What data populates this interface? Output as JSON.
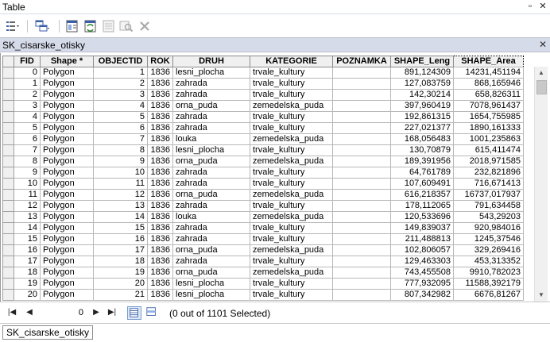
{
  "window": {
    "title": "Table",
    "pin_glyph": "▫",
    "close_glyph": "✕"
  },
  "tab": {
    "title": "SK_cisarske_otisky",
    "close_glyph": "✕"
  },
  "columns": [
    "",
    "FID",
    "Shape *",
    "OBJECTID",
    "ROK",
    "DRUH",
    "KATEGORIE",
    "POZNAMKA",
    "SHAPE_Leng",
    "SHAPE_Area"
  ],
  "rows": [
    [
      "0",
      "Polygon",
      "1",
      "1836",
      "lesni_plocha",
      "trvale_kultury",
      "",
      "891,124309",
      "14231,451194"
    ],
    [
      "1",
      "Polygon",
      "2",
      "1836",
      "zahrada",
      "trvale_kultury",
      "",
      "127,083759",
      "868,165946"
    ],
    [
      "2",
      "Polygon",
      "3",
      "1836",
      "zahrada",
      "trvale_kultury",
      "",
      "142,30214",
      "658,826311"
    ],
    [
      "3",
      "Polygon",
      "4",
      "1836",
      "orna_puda",
      "zemedelska_puda",
      "",
      "397,960419",
      "7078,961437"
    ],
    [
      "4",
      "Polygon",
      "5",
      "1836",
      "zahrada",
      "trvale_kultury",
      "",
      "192,861315",
      "1654,755985"
    ],
    [
      "5",
      "Polygon",
      "6",
      "1836",
      "zahrada",
      "trvale_kultury",
      "",
      "227,021377",
      "1890,161333"
    ],
    [
      "6",
      "Polygon",
      "7",
      "1836",
      "louka",
      "zemedelska_puda",
      "",
      "168,056483",
      "1001,235863"
    ],
    [
      "7",
      "Polygon",
      "8",
      "1836",
      "lesni_plocha",
      "trvale_kultury",
      "",
      "130,70879",
      "615,411474"
    ],
    [
      "8",
      "Polygon",
      "9",
      "1836",
      "orna_puda",
      "zemedelska_puda",
      "",
      "189,391956",
      "2018,971585"
    ],
    [
      "9",
      "Polygon",
      "10",
      "1836",
      "zahrada",
      "trvale_kultury",
      "",
      "64,761789",
      "232,821896"
    ],
    [
      "10",
      "Polygon",
      "11",
      "1836",
      "zahrada",
      "trvale_kultury",
      "",
      "107,609491",
      "716,671413"
    ],
    [
      "11",
      "Polygon",
      "12",
      "1836",
      "orna_puda",
      "zemedelska_puda",
      "",
      "616,218357",
      "16737,017937"
    ],
    [
      "12",
      "Polygon",
      "13",
      "1836",
      "zahrada",
      "trvale_kultury",
      "",
      "178,112065",
      "791,634458"
    ],
    [
      "13",
      "Polygon",
      "14",
      "1836",
      "louka",
      "zemedelska_puda",
      "",
      "120,533696",
      "543,29203"
    ],
    [
      "14",
      "Polygon",
      "15",
      "1836",
      "zahrada",
      "trvale_kultury",
      "",
      "149,839037",
      "920,984016"
    ],
    [
      "15",
      "Polygon",
      "16",
      "1836",
      "zahrada",
      "trvale_kultury",
      "",
      "211,488813",
      "1245,37546"
    ],
    [
      "16",
      "Polygon",
      "17",
      "1836",
      "orna_puda",
      "zemedelska_puda",
      "",
      "102,806057",
      "329,269416"
    ],
    [
      "17",
      "Polygon",
      "18",
      "1836",
      "zahrada",
      "trvale_kultury",
      "",
      "129,463303",
      "453,313352"
    ],
    [
      "18",
      "Polygon",
      "19",
      "1836",
      "orna_puda",
      "zemedelska_puda",
      "",
      "743,455508",
      "9910,782023"
    ],
    [
      "19",
      "Polygon",
      "20",
      "1836",
      "lesni_plocha",
      "trvale_kultury",
      "",
      "777,932095",
      "11588,392179"
    ],
    [
      "20",
      "Polygon",
      "21",
      "1836",
      "lesni_plocha",
      "trvale_kultury",
      "",
      "807,342982",
      "6676,81267"
    ]
  ],
  "navigation": {
    "current_record": "0",
    "status": "(0 out of 1101 Selected)"
  },
  "bottom_tab": {
    "label": "SK_cisarske_otisky"
  },
  "icons": {
    "table-options": "table-options-icon",
    "related-tables": "related-tables-icon",
    "select-by-attributes": "select-by-attributes-icon",
    "switch-selection": "switch-selection-icon",
    "clear-selection": "clear-selection-icon",
    "zoom-to-selected": "zoom-to-selected-icon",
    "delete-selected": "delete-selected-icon"
  },
  "colors": {
    "tab_bar": "#d6dbe9",
    "header_bg": "#f0f0f0",
    "grid_line": "#b8b8b8",
    "active_view": "#dde8f7"
  }
}
